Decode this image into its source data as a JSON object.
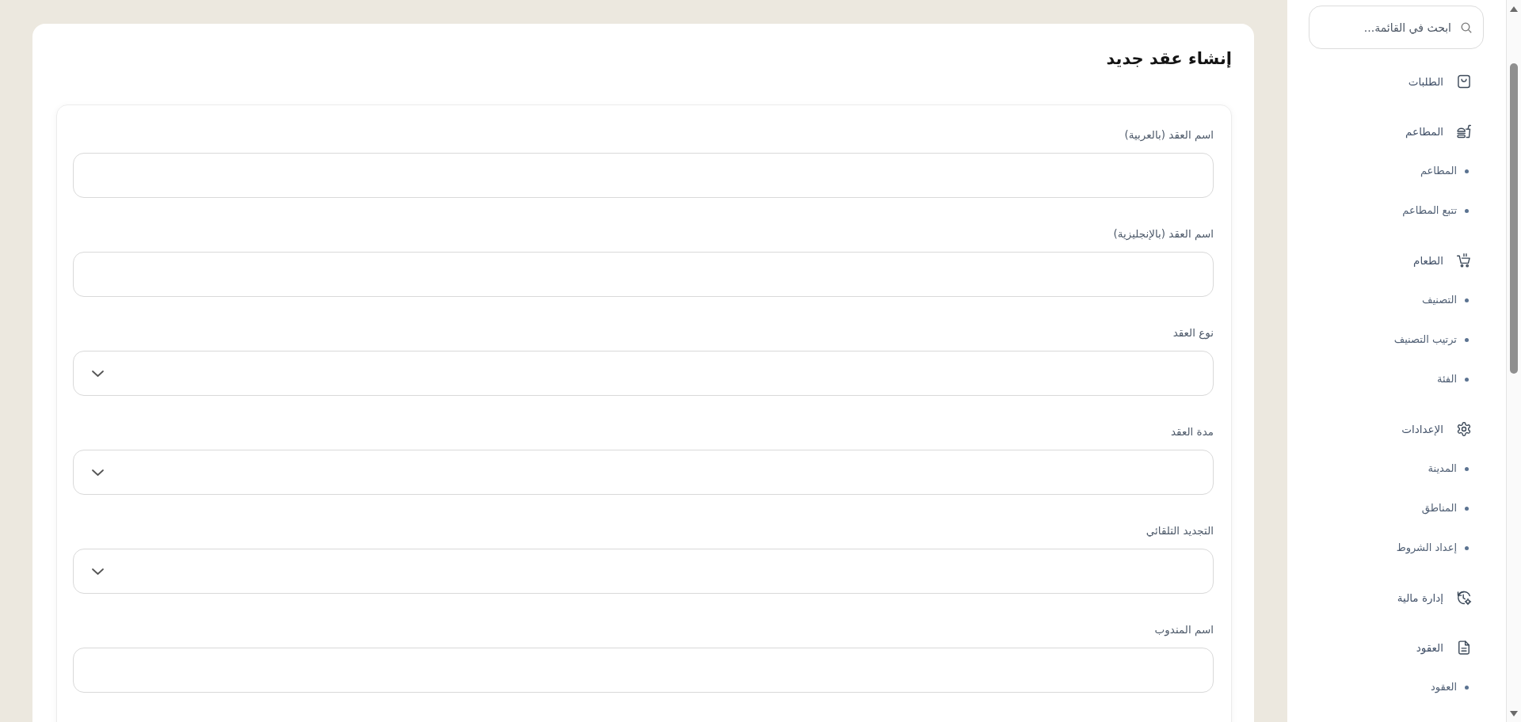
{
  "page": {
    "title": "إنشاء عقد جديد"
  },
  "form": {
    "fields": [
      {
        "kind": "text",
        "label": "اسم العقد (بالعربية)"
      },
      {
        "kind": "text",
        "label": "اسم العقد (بالإنجليزية)"
      },
      {
        "kind": "select",
        "label": "نوع العقد"
      },
      {
        "kind": "select",
        "label": "مدة العقد"
      },
      {
        "kind": "select",
        "label": "التجديد التلقائي"
      },
      {
        "kind": "text",
        "label": "اسم المندوب"
      }
    ]
  },
  "sidebar": {
    "search": {
      "placeholder": "ابحث في القائمة..."
    },
    "items": [
      {
        "label": "الطلبات"
      },
      {
        "label": "المطاعم",
        "children": [
          {
            "label": "المطاعم"
          },
          {
            "label": "تتبع المطاعم"
          }
        ]
      },
      {
        "label": "الطعام",
        "children": [
          {
            "label": "التصنيف"
          },
          {
            "label": "ترتيب التصنيف"
          },
          {
            "label": "الفئة"
          }
        ]
      },
      {
        "label": "الإعدادات",
        "children": [
          {
            "label": "المدينة"
          },
          {
            "label": "المناطق"
          },
          {
            "label": "إعداد الشروط"
          }
        ]
      },
      {
        "label": "إدارة مالية"
      },
      {
        "label": "العقود",
        "children": [
          {
            "label": "العقود"
          }
        ]
      }
    ]
  }
}
